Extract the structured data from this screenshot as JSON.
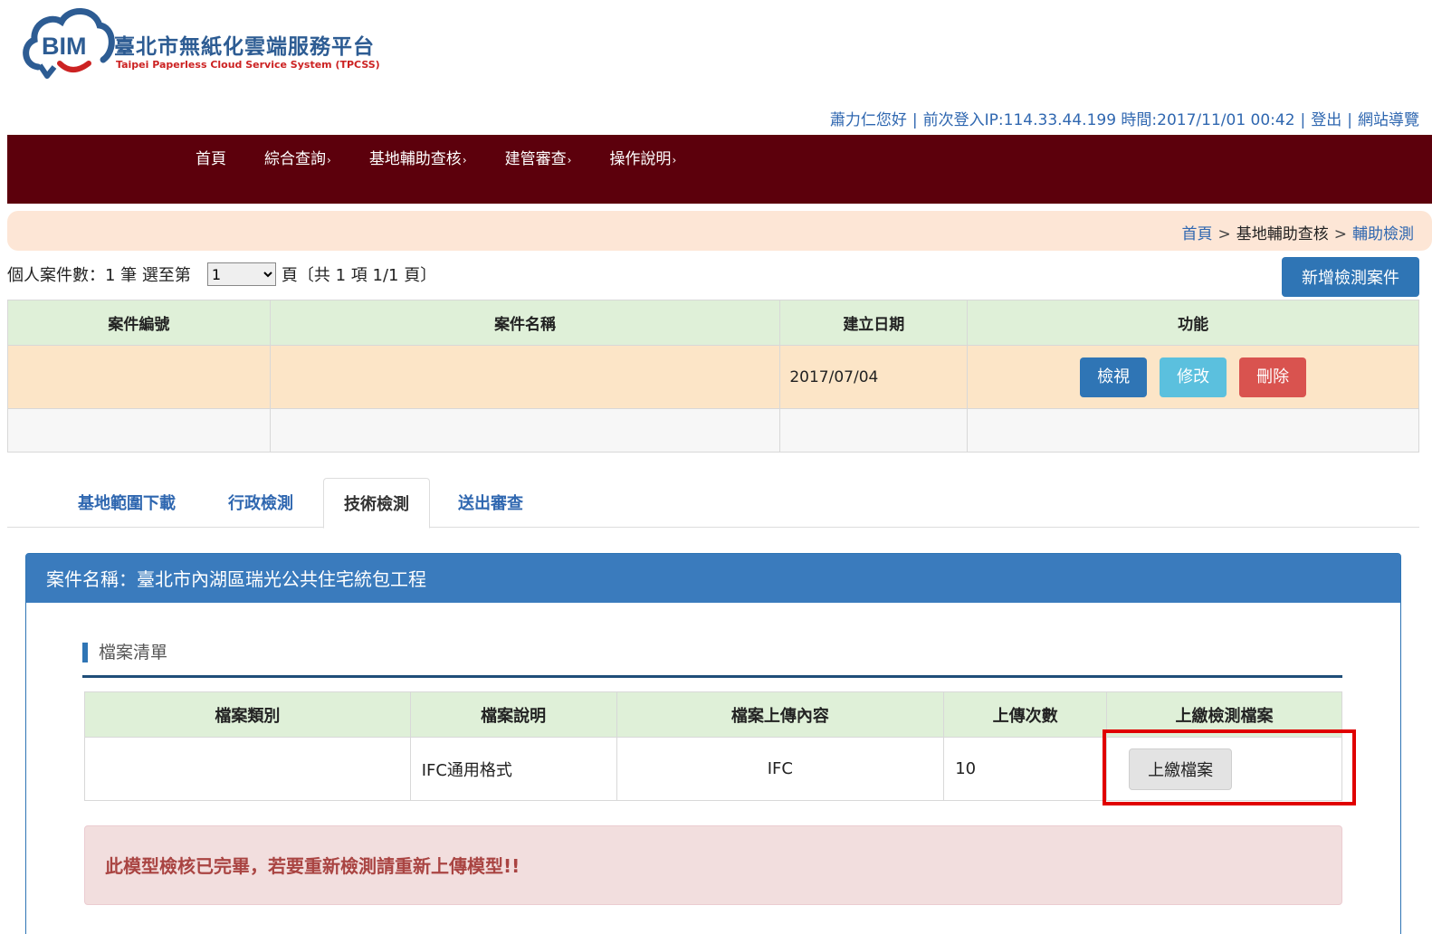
{
  "logo": {
    "mark_text": "BIM",
    "title": "臺北市無紙化雲端服務平台",
    "subtitle": "Taipei Paperless Cloud Service System (TPCSS)",
    "colors": {
      "blue": "#2d5c93",
      "red": "#cc2222"
    }
  },
  "userbar": {
    "greeting": "蕭力仁您好",
    "last_login": "前次登入IP:114.33.44.199 時間:2017/11/01 00:42",
    "logout": "登出",
    "sitemap": "網站導覽"
  },
  "nav": {
    "items": [
      "首頁",
      "綜合查詢",
      "基地輔助查核",
      "建管審查",
      "操作說明"
    ],
    "arrow": "›",
    "color": "#5c000c"
  },
  "breadcrumb": {
    "home": "首頁",
    "section": "基地輔助查核",
    "current": "輔助檢測",
    "sep": ">"
  },
  "pager": {
    "prefix": "個人案件數：1 筆 選至第",
    "selected_page": "1",
    "suffix": "頁〔共 1 項 1/1 頁〕"
  },
  "add_case_button": "新增檢測案件",
  "case_table": {
    "headers": [
      "案件編號",
      "案件名稱",
      "建立日期",
      "功能"
    ],
    "rows": [
      {
        "number": "",
        "name": "",
        "date": "2017/07/04"
      }
    ],
    "actions": {
      "view": "檢視",
      "edit": "修改",
      "delete": "刪除"
    }
  },
  "tabs": {
    "items": [
      "基地範圍下載",
      "行政檢測",
      "技術檢測",
      "送出審查"
    ],
    "active_index": 2
  },
  "panel": {
    "title": "案件名稱：臺北市內湖區瑞光公共住宅統包工程",
    "section_title": "檔案清單",
    "file_table": {
      "headers": [
        "檔案類別",
        "檔案說明",
        "檔案上傳內容",
        "上傳次數",
        "上繳檢測檔案"
      ],
      "rows": [
        {
          "category": "",
          "description": "IFC通用格式",
          "content": "IFC",
          "count": "10",
          "upload": "上繳檔案"
        }
      ]
    },
    "alert": "此模型檢核已完畢，若要重新檢測請重新上傳模型!!"
  },
  "highlight_color": "#e00000"
}
